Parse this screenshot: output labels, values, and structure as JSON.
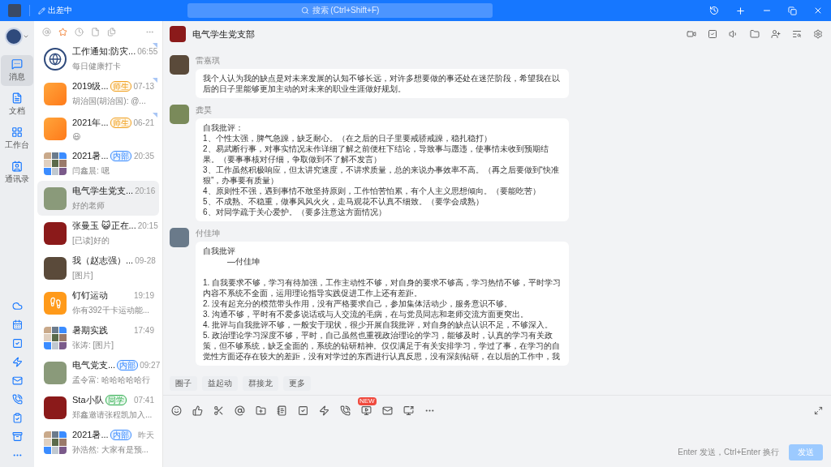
{
  "top_bar": {
    "status": "出差中",
    "search": {
      "placeholder": "搜索 (Ctrl+Shift+F)"
    }
  },
  "rail": {
    "nav": [
      {
        "label": "消息",
        "kind": "message",
        "selected": true
      },
      {
        "label": "文档",
        "kind": "doc",
        "selected": false
      },
      {
        "label": "工作台",
        "kind": "apps",
        "selected": false
      },
      {
        "label": "通讯录",
        "kind": "contacts",
        "selected": false
      }
    ]
  },
  "filters": [
    {
      "kind": "at",
      "selected": false
    },
    {
      "kind": "star",
      "selected": true
    },
    {
      "kind": "clock",
      "selected": false
    },
    {
      "kind": "doc",
      "selected": false
    },
    {
      "kind": "file",
      "selected": false
    }
  ],
  "conversations": [
    {
      "name": "工作通知:防灾...",
      "time": "06:55",
      "preview": "每日健康打卡",
      "kind": "logo",
      "pinned": true,
      "selected": false
    },
    {
      "name": "2019级...",
      "tag": {
        "label": "师生",
        "kind": "teacher"
      },
      "time": "07-13",
      "preview": "胡治国(胡治国): @...",
      "kind": "app",
      "pinned": true,
      "selected": false
    },
    {
      "name": "2021年...",
      "tag": {
        "label": "师生",
        "kind": "teacher"
      },
      "time": "06-21",
      "preview": "😃",
      "kind": "app",
      "pinned": true,
      "selected": false
    },
    {
      "name": "2021暑...",
      "tag": {
        "label": "内部",
        "kind": "internal"
      },
      "time": "20:35",
      "preview": "闫鑫晨: 嗯",
      "kind": "grid",
      "pinned": false,
      "selected": false
    },
    {
      "name": "电气学生党支...",
      "time": "20:16",
      "preview": "好的老师",
      "kind": "photo",
      "pinned": false,
      "selected": true
    },
    {
      "name": "张曼玉 😺正在...",
      "time": "20:15",
      "preview": "[已读]好的",
      "kind": "photo",
      "pinned": false,
      "selected": false
    },
    {
      "name": "我（赵志强）...",
      "time": "09-28",
      "preview": "[图片]",
      "kind": "photo",
      "pinned": false,
      "selected": false
    },
    {
      "name": "钉钉运动",
      "time": "19:19",
      "preview": "你有392千卡运动能...",
      "kind": "sport",
      "pinned": false,
      "selected": false
    },
    {
      "name": "暑期实践",
      "time": "17:49",
      "preview": "张涛: [图片]",
      "kind": "grid",
      "pinned": false,
      "selected": false
    },
    {
      "name": "电气党支...",
      "tag": {
        "label": "内部",
        "kind": "internal"
      },
      "time": "09:27",
      "preview": "孟令富: 哈哈哈哈哈行",
      "kind": "photo",
      "pinned": false,
      "selected": false
    },
    {
      "name": "Sta小队",
      "tag": {
        "label": "同学",
        "kind": "classmate"
      },
      "time": "07:41",
      "preview": "郑鑫邀请张程凯加入...",
      "kind": "photo",
      "pinned": false,
      "selected": false
    },
    {
      "name": "2021暑...",
      "tag": {
        "label": "内部",
        "kind": "internal"
      },
      "time": "昨天",
      "preview": "孙浩然: 大家有是预...",
      "kind": "grid",
      "pinned": false,
      "selected": false
    }
  ],
  "chat": {
    "title": "电气学生党支部",
    "messages": [
      {
        "sender": "雷嘉琪",
        "paragraphs": [
          [
            "我个人认为我的缺点是对未来发展的认知不够长远，对许多想要做的事还处在迷茫阶段，希望我在以后的日子里能够更加主动的对未来的职业生涯做好规划。"
          ]
        ]
      },
      {
        "sender": "龚昊",
        "paragraphs": [
          [
            "自我批评：",
            "1、个性太强，脾气急躁，缺乏耐心。（在之后的日子里要戒骄戒躁，稳扎稳打）",
            "2、易武断行事，对事实情况未作详细了解之前便枉下结论，导致事与愿违，使事情未收到预期结果。（要事事核对仔细，争取做到不了解不发言）",
            "3、工作虽然积极响应，但太讲究速度，不讲求质量，总的来说办事效率不高。（再之后要做到“快准狠”，办事要有质量）",
            "4、原则性不强，遇到事情不敢坚持原则，工作怕苦怕累，有个人主义思想倾向。（要能吃苦）",
            "5、不成熟、不稳重，做事风风火火，走马观花不认真不细致。（要学会成熟）",
            "6、对同学疏于关心爱护。（要多注意这方面情况）"
          ]
        ]
      },
      {
        "sender": "付佳坤",
        "paragraphs": [
          [
            "自我批评",
            "　　　—付佳坤"
          ],
          [
            "1. 自我要求不够，学习有待加强，工作主动性不够，对自身的要求不够高，学习热情不够，平时学习内容不系统不全面，运用理论指导实践促进工作上还有差距。",
            "2. 没有起充分的模范带头作用，没有严格要求自己，参加集体活动少，服务意识不够。",
            "3. 沟通不够，平时有不爱多说话或与人交流的毛病，在与党员同志和老师交流方面更突出。",
            "4. 批评与自我批评不够，一般安于现状，很少开展自我批评，对自身的缺点认识不足，不够深入。",
            "5. 政治理论学习深度不够，平时，自己虽然也重视政治理论的学习，能够及时，认真的学习有关政策，但不够系统，缺乏全面的，系统的钻研精神。仅仅满足于有关安排学习，学过了事，在学习的自觉性方面还存在较大的差距，没有对学过的东西进行认真反思，没有深刻钻研，在以后的工作中，我"
          ]
        ]
      }
    ],
    "quick_actions": [
      "圈子",
      "益起动",
      "群接龙",
      "更多"
    ],
    "toolbar": [
      {
        "kind": "emoji"
      },
      {
        "kind": "like"
      },
      {
        "kind": "cut"
      },
      {
        "kind": "at"
      },
      {
        "kind": "folder"
      },
      {
        "kind": "note"
      },
      {
        "kind": "todo"
      },
      {
        "kind": "ding"
      },
      {
        "kind": "call"
      },
      {
        "kind": "live",
        "badge": "NEW"
      },
      {
        "kind": "mail"
      },
      {
        "kind": "screen"
      },
      {
        "kind": "more"
      }
    ],
    "hint": "Enter 发送，Ctrl+Enter 换行",
    "send": {
      "label": "发送",
      "disabled": true
    }
  }
}
